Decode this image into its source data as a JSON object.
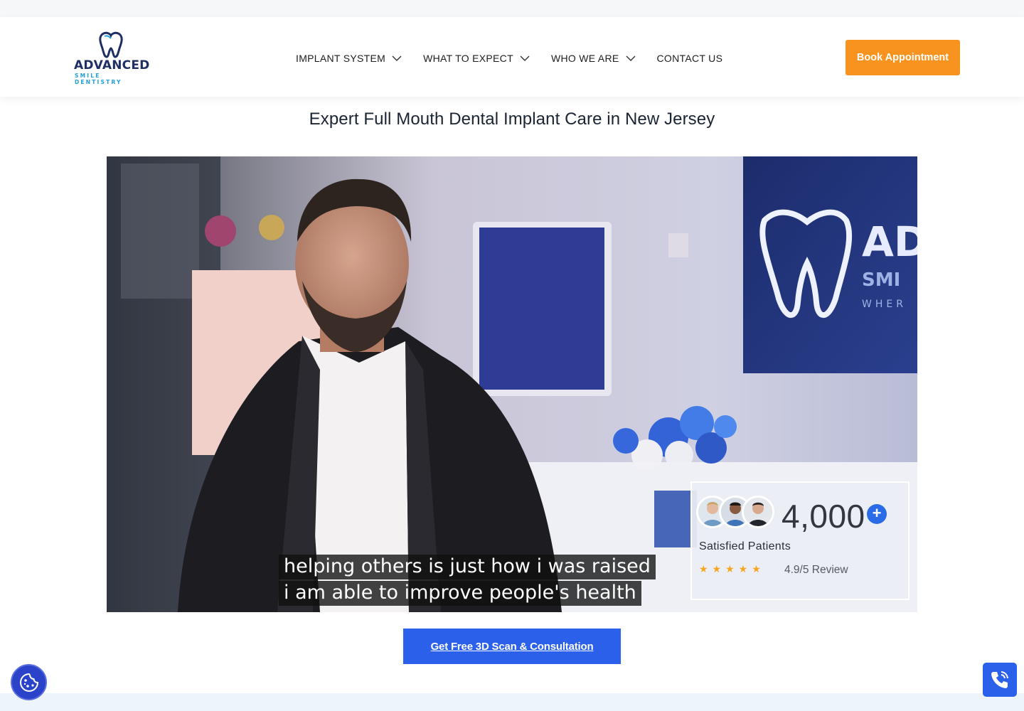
{
  "header": {
    "logo": {
      "brand": "ADVANCED",
      "sub": "SMILE DENTISTRY"
    },
    "nav": [
      {
        "label": "IMPLANT SYSTEM",
        "has_dropdown": true
      },
      {
        "label": "WHAT TO EXPECT",
        "has_dropdown": true
      },
      {
        "label": "WHO WE ARE",
        "has_dropdown": true
      },
      {
        "label": "CONTACT US",
        "has_dropdown": false
      }
    ],
    "book_label": "Book Appointment"
  },
  "hero": {
    "headline": "Expert Full Mouth Dental Implant Care in New Jersey",
    "video": {
      "captions": [
        "helping others is just how i was raised",
        "i am able to improve people's health"
      ]
    },
    "stats_card": {
      "count": "4,000",
      "plus": "+",
      "label": "Satisfied Patients",
      "stars": "★★★★★",
      "rating": "4.9/5 Review"
    },
    "cta_label": "Get Free 3D Scan & Consultation"
  },
  "floating": {
    "cookie_icon": "cookie-icon",
    "phone_icon": "phone-call-icon"
  },
  "colors": {
    "accent_orange": "#f7931e",
    "accent_blue": "#2b61ea",
    "brand_navy": "#1f2f66",
    "brand_cyan": "#1fa0d8"
  }
}
